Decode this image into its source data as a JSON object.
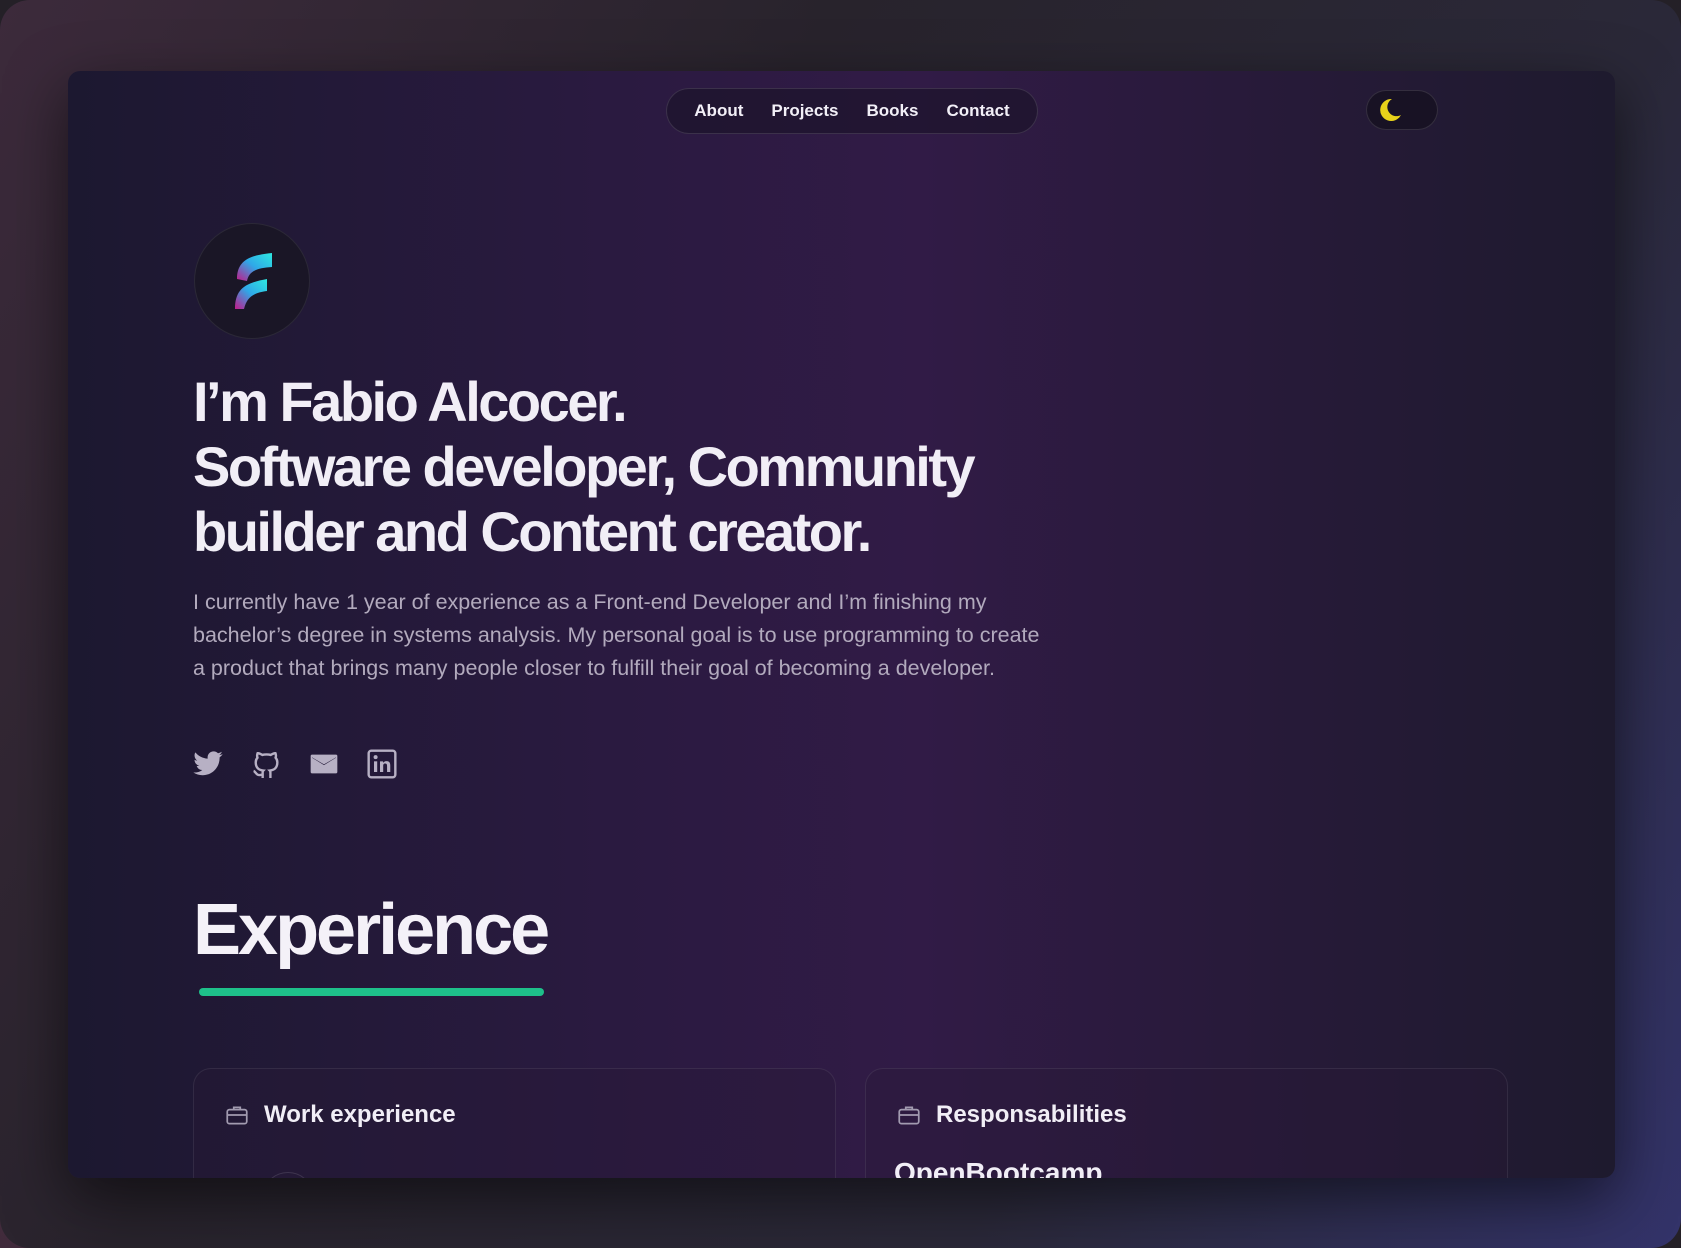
{
  "nav": {
    "items": [
      {
        "label": "About"
      },
      {
        "label": "Projects"
      },
      {
        "label": "Books"
      },
      {
        "label": "Contact"
      }
    ]
  },
  "theme_toggle": {
    "icon": "moon-icon",
    "color": "#e8d21a"
  },
  "avatar": {
    "icon": "logo-f-icon"
  },
  "hero": {
    "headline_line1": "I’m Fabio Alcocer.",
    "headline_line2": "Software developer, Community",
    "headline_line3": "builder and Content creator.",
    "bio": "I currently have 1 year of experience as a Front-end Developer and I’m finishing my bachelor’s degree in systems analysis. My personal goal is to use programming to create a product that brings many people closer to fulfill their goal of becoming a developer."
  },
  "socials": [
    {
      "icon": "twitter-icon"
    },
    {
      "icon": "github-icon"
    },
    {
      "icon": "mail-icon"
    },
    {
      "icon": "linkedin-icon"
    }
  ],
  "experience": {
    "title": "Experience",
    "accent": "#1ec08a",
    "cards": [
      {
        "title": "Work experience",
        "icon": "briefcase-icon"
      },
      {
        "title": "Responsabilities",
        "icon": "briefcase-icon",
        "subtitle": "OpenBootcamp"
      }
    ]
  }
}
